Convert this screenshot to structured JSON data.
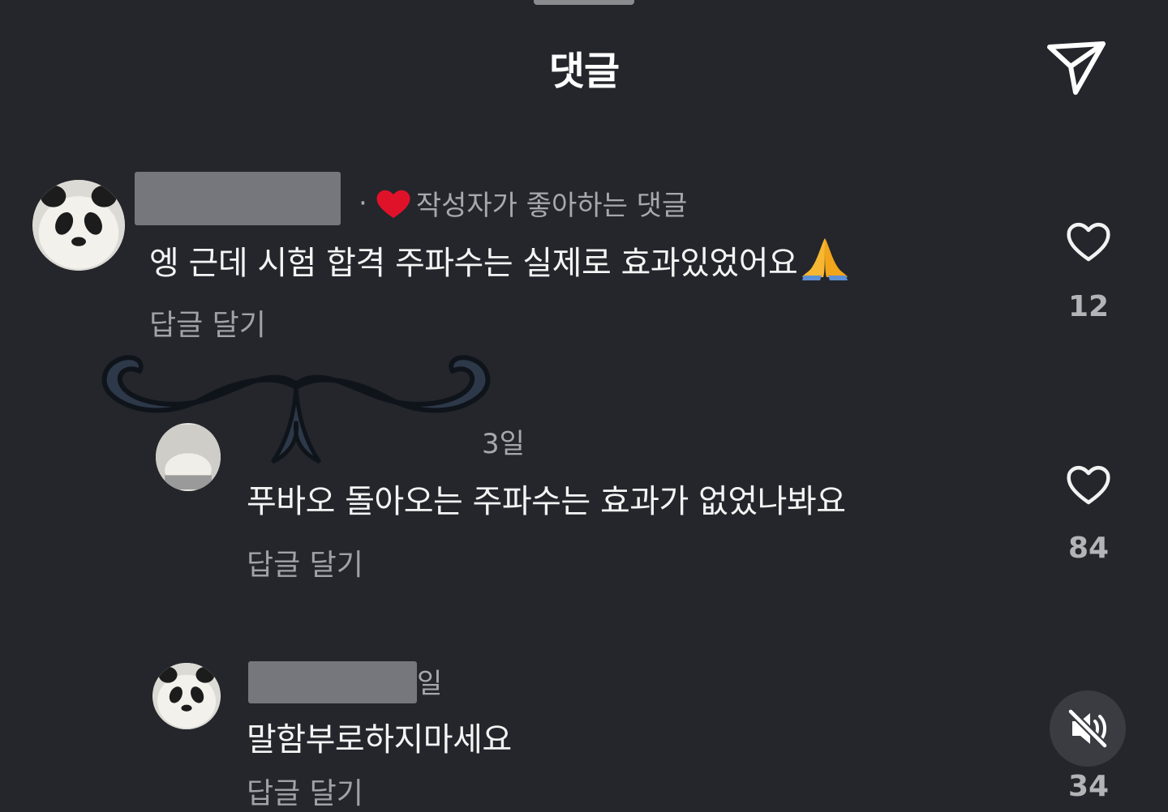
{
  "header": {
    "title": "댓글"
  },
  "icons": {
    "share": "paper-plane-icon",
    "like": "heart-outline-icon",
    "creator_like": "red-heart-icon",
    "mute": "speaker-muted-icon",
    "emoji": "folded-hands-emoji"
  },
  "colors": {
    "background": "#24262b",
    "creator_heart": "#e0122a"
  },
  "comments": [
    {
      "meta_dot": "·",
      "creator_liked_label": "작성자가 좋아하는 댓글",
      "text": "엥 근데 시험 합격 주파수는 실제로 효과있었어요",
      "reply_label": "답글 달기",
      "likes": "12"
    },
    {
      "time": "3일",
      "text": "푸바오 돌아오는 주파수는 효과가 없었나봐요",
      "reply_label": "답글 달기",
      "likes": "84"
    },
    {
      "time": "일",
      "text": "말함부로하지마세요",
      "reply_label": "답글 달기",
      "likes": "34"
    }
  ]
}
